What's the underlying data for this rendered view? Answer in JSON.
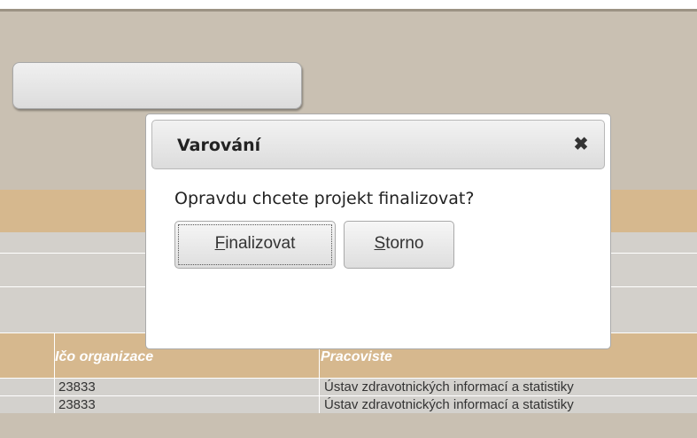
{
  "dialog": {
    "title": "Varování",
    "close_glyph": "✖",
    "message": "Opravdu chcete projekt finalizovat?",
    "buttons": {
      "finalize": {
        "accel": "F",
        "rest": "inalizovat"
      },
      "cancel": {
        "accel": "S",
        "rest": "torno"
      }
    }
  },
  "table": {
    "headers": [
      "Ičo organizace",
      "Pracoviste"
    ],
    "rows": [
      [
        "23833",
        "Ústav zdravotnických informací a statistiky"
      ],
      [
        "23833",
        "Ústav zdravotnických informací a statistiky"
      ]
    ]
  },
  "colors": {
    "background": "#c9c0b2",
    "header_band": "#d6b88e",
    "row_bg": "#d3d1cd",
    "dialog_bg": "#ffffff"
  },
  "icons": {
    "close": "close-icon"
  }
}
